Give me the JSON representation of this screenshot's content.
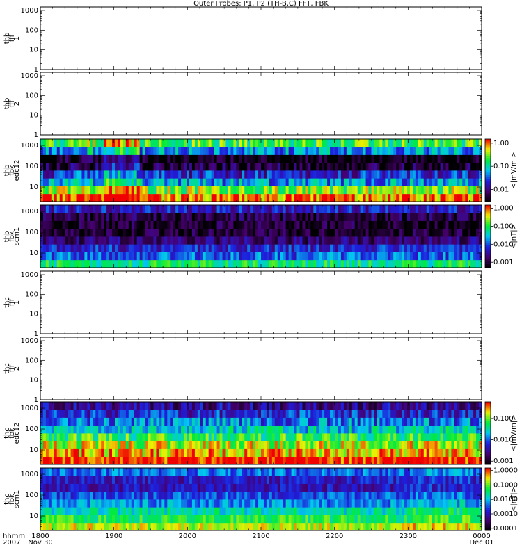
{
  "title": "Outer Probes: P1, P2 (TH-B,C) FFT, FBK",
  "chart_data": {
    "type": "heatmap",
    "title": "Outer Probes: P1, P2 (TH-B,C) FFT, FBK",
    "x_axis": {
      "label_lines": [
        "hhmm",
        "2007"
      ],
      "ticks": [
        "1800",
        "1900",
        "2000",
        "2100",
        "2200",
        "2300",
        "0000"
      ],
      "date_labels": [
        {
          "at": "1800",
          "text": "Nov 30"
        },
        {
          "at": "0000",
          "text": "Dec 01"
        }
      ],
      "range": [
        "2007-11-30T18:00",
        "2007-12-01T00:00"
      ]
    },
    "panels": [
      {
        "ylabel_lines": [
          "thb",
          "fff",
          "1"
        ],
        "yscale": "log",
        "ylim": [
          1,
          1500
        ],
        "yticks": [
          "1",
          "10",
          "100",
          "1000"
        ],
        "data": "none"
      },
      {
        "ylabel_lines": [
          "thb",
          "fff",
          "2"
        ],
        "yscale": "log",
        "ylim": [
          1,
          1500
        ],
        "yticks": [
          "1",
          "10",
          "100",
          "1000"
        ],
        "data": "none"
      },
      {
        "ylabel_lines": [
          "thb",
          "fbk",
          "edc12"
        ],
        "yscale": "log",
        "ylim": [
          2,
          2000
        ],
        "yticks": [
          "10",
          "100",
          "1000"
        ],
        "colorbar": {
          "label": "<|mV/m|>",
          "scale": "log",
          "ticks": [
            "0.01",
            "0.10",
            "1.00"
          ],
          "range": [
            0.003,
            1.5
          ]
        },
        "band_levels": [
          1.0,
          0.3,
          0.05,
          0.02,
          0.005,
          0.003,
          0.05,
          0.2
        ],
        "event_boost": [
          {
            "from": "1820",
            "to": "1850",
            "factor": 1.5
          },
          {
            "from": "1850",
            "to": "1920",
            "factor": 3
          }
        ]
      },
      {
        "ylabel_lines": [
          "thb",
          "fbk",
          "scm1"
        ],
        "yscale": "log",
        "ylim": [
          2,
          2000
        ],
        "yticks": [
          "10",
          "100",
          "1000"
        ],
        "colorbar": {
          "label": "<|nT|>",
          "scale": "log",
          "ticks": [
            "0.001",
            "0.010",
            "0.100",
            "1.000"
          ],
          "range": [
            0.0005,
            1.5
          ]
        },
        "band_levels": [
          0.07,
          0.012,
          0.006,
          0.002,
          0.0009,
          0.0009,
          0.0012,
          0.005
        ]
      },
      {
        "ylabel_lines": [
          "thc",
          "fff",
          "1"
        ],
        "yscale": "log",
        "ylim": [
          1,
          1500
        ],
        "yticks": [
          "1",
          "10",
          "100",
          "1000"
        ],
        "data": "none"
      },
      {
        "ylabel_lines": [
          "thc",
          "fff",
          "2"
        ],
        "yscale": "log",
        "ylim": [
          1,
          1500
        ],
        "yticks": [
          "1",
          "10",
          "100",
          "1000"
        ],
        "data": "none"
      },
      {
        "ylabel_lines": [
          "thc",
          "fbk",
          "edc12"
        ],
        "yscale": "log",
        "ylim": [
          2,
          2000
        ],
        "yticks": [
          "10",
          "100",
          "1000"
        ],
        "colorbar": {
          "label": "<|mV/m|>",
          "scale": "log",
          "ticks": [
            "0.001",
            "0.010",
            "0.100"
          ],
          "range": [
            0.0007,
            0.6
          ]
        },
        "band_levels": [
          0.6,
          0.25,
          0.15,
          0.06,
          0.025,
          0.012,
          0.006,
          0.003
        ]
      },
      {
        "ylabel_lines": [
          "thc",
          "fbk",
          "scm1"
        ],
        "yscale": "log",
        "ylim": [
          2,
          2000
        ],
        "yticks": [
          "10",
          "100",
          "1000"
        ],
        "colorbar": {
          "label": "<|nT|>",
          "scale": "log",
          "ticks": [
            "0.0001",
            "0.0010",
            "0.0100",
            "0.1000",
            "1.0000"
          ],
          "range": [
            7e-05,
            1.5
          ]
        },
        "band_levels": [
          0.2,
          0.05,
          0.02,
          0.006,
          0.003,
          0.001,
          0.0012,
          0.004
        ],
        "event_boost": [
          {
            "from": "2300",
            "to": "2350",
            "factor": 1.6
          }
        ]
      }
    ]
  }
}
